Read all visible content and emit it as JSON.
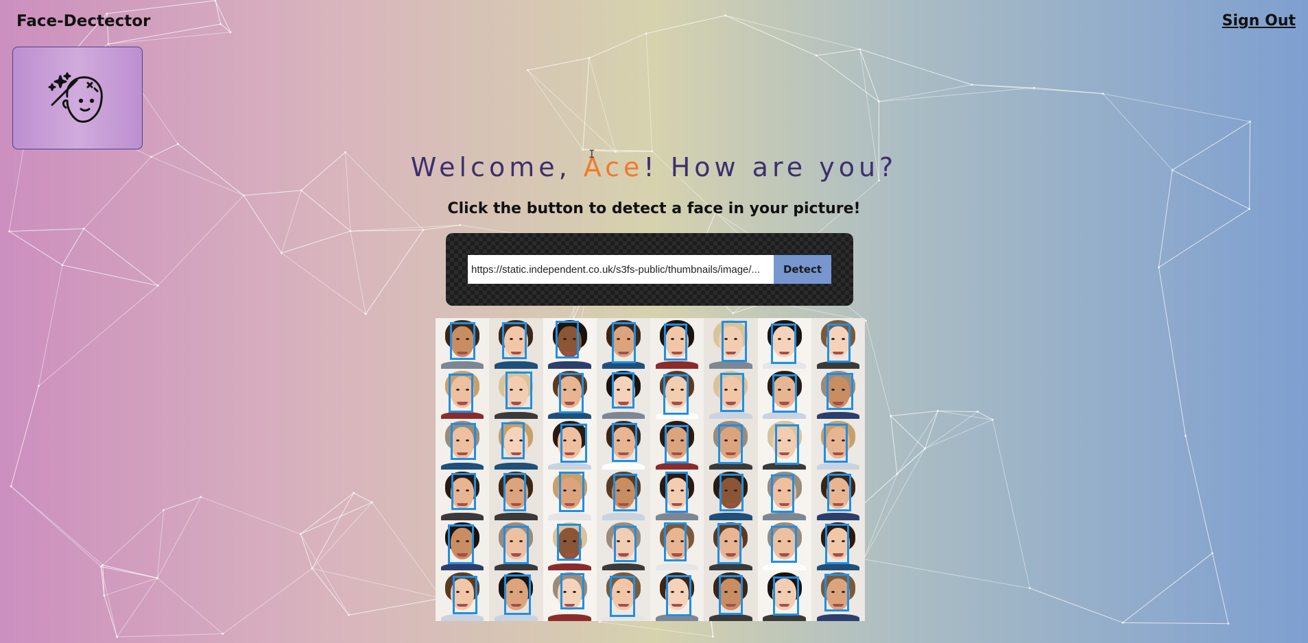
{
  "header": {
    "brand": "Face-Dectector",
    "sign_out_label": "Sign Out",
    "logo_icon": "magic-face-icon"
  },
  "welcome": {
    "prefix": "Welcome, ",
    "name": "Ace",
    "suffix": "! How are you?"
  },
  "subtitle": "Click the button to detect a face in your picture!",
  "form": {
    "url_value": "https://static.independent.co.uk/s3fs-public/thumbnails/image/...",
    "detect_label": "Detect"
  },
  "result": {
    "grid_rows": 6,
    "grid_cols": 8,
    "faces_detected": 48,
    "box_color": "#1e8fe6"
  },
  "colors": {
    "welcome_text": "#3d2f6e",
    "name_accent": "#f2792b",
    "detect_button": "#7896cf"
  }
}
